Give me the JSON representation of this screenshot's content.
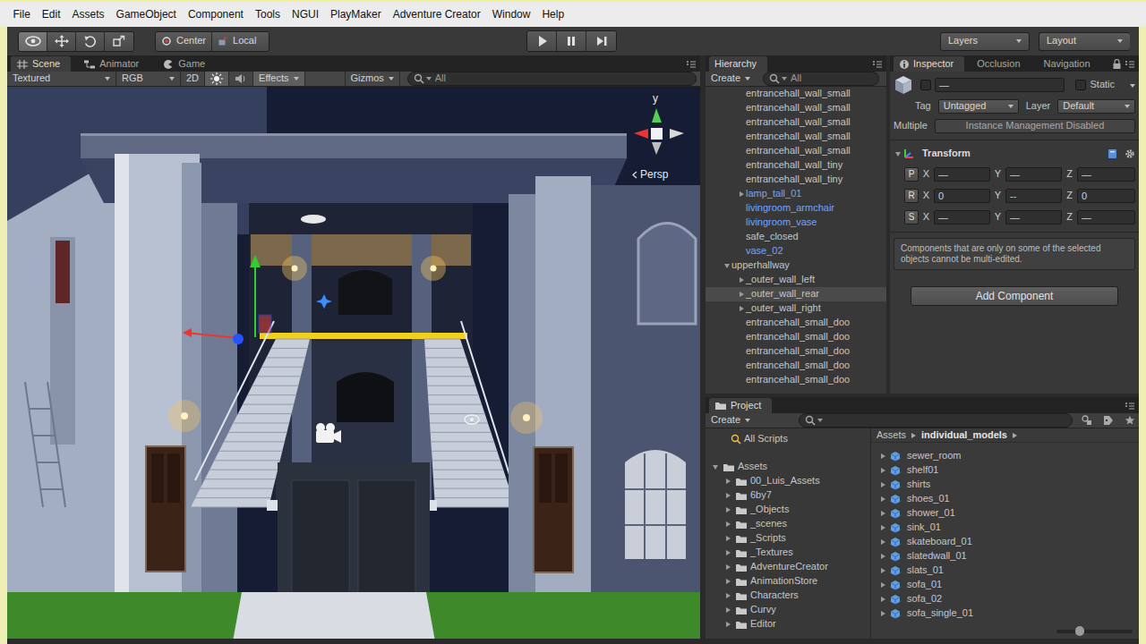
{
  "menu": {
    "items": [
      "File",
      "Edit",
      "Assets",
      "GameObject",
      "Component",
      "Tools",
      "NGUI",
      "PlayMaker",
      "Adventure Creator",
      "Window",
      "Help"
    ]
  },
  "toolbar": {
    "tools": [
      {
        "selected": true
      },
      {
        "selected": false
      },
      {
        "selected": false
      },
      {
        "selected": false
      }
    ],
    "pivot_mode": "Center",
    "pivot_rotation": "Local",
    "layers": "Layers",
    "layout": "Layout"
  },
  "scene": {
    "tabs": [
      {
        "label": "Scene",
        "selected": true
      },
      {
        "label": "Animator",
        "selected": false
      },
      {
        "label": "Game",
        "selected": false
      }
    ],
    "shading": "Textured",
    "render_mode": "RGB",
    "mode_2d": "2D",
    "mode_2d_on": false,
    "lighting_on": true,
    "audio_on": false,
    "effects": "Effects",
    "effects_on": true,
    "gizmos": "Gizmos",
    "search": {
      "placeholder": "All"
    },
    "axis_label": "y",
    "projection": "Persp"
  },
  "hierarchy": {
    "tab": "Hierarchy",
    "create": "Create",
    "search": {
      "placeholder": "All"
    },
    "items": [
      {
        "label": "entrancehall_wall_small",
        "depth": 1,
        "has_children": false,
        "expanded": false,
        "prefab": false,
        "selected": false
      },
      {
        "label": "entrancehall_wall_small",
        "depth": 1,
        "has_children": false,
        "expanded": false,
        "prefab": false,
        "selected": false
      },
      {
        "label": "entrancehall_wall_small",
        "depth": 1,
        "has_children": false,
        "expanded": false,
        "prefab": false,
        "selected": false
      },
      {
        "label": "entrancehall_wall_small",
        "depth": 1,
        "has_children": false,
        "expanded": false,
        "prefab": false,
        "selected": false
      },
      {
        "label": "entrancehall_wall_small",
        "depth": 1,
        "has_children": false,
        "expanded": false,
        "prefab": false,
        "selected": false
      },
      {
        "label": "entrancehall_wall_tiny",
        "depth": 1,
        "has_children": false,
        "expanded": false,
        "prefab": false,
        "selected": false
      },
      {
        "label": "entrancehall_wall_tiny",
        "depth": 1,
        "has_children": false,
        "expanded": false,
        "prefab": false,
        "selected": false
      },
      {
        "label": "lamp_tall_01",
        "depth": 1,
        "has_children": true,
        "expanded": false,
        "prefab": true,
        "selected": false
      },
      {
        "label": "livingroom_armchair",
        "depth": 1,
        "has_children": false,
        "expanded": false,
        "prefab": true,
        "selected": false
      },
      {
        "label": "livingroom_vase",
        "depth": 1,
        "has_children": false,
        "expanded": false,
        "prefab": true,
        "selected": false
      },
      {
        "label": "safe_closed",
        "depth": 1,
        "has_children": false,
        "expanded": false,
        "prefab": false,
        "selected": false
      },
      {
        "label": "vase_02",
        "depth": 1,
        "has_children": false,
        "expanded": false,
        "prefab": true,
        "selected": false
      },
      {
        "label": "upperhallway",
        "depth": 0,
        "has_children": true,
        "expanded": true,
        "prefab": false,
        "selected": false
      },
      {
        "label": "_outer_wall_left",
        "depth": 1,
        "has_children": true,
        "expanded": false,
        "prefab": false,
        "selected": false
      },
      {
        "label": "_outer_wall_rear",
        "depth": 1,
        "has_children": true,
        "expanded": false,
        "prefab": false,
        "selected": true
      },
      {
        "label": "_outer_wall_right",
        "depth": 1,
        "has_children": true,
        "expanded": false,
        "prefab": false,
        "selected": false
      },
      {
        "label": "entrancehall_small_doo",
        "depth": 1,
        "has_children": false,
        "expanded": false,
        "prefab": false,
        "selected": false
      },
      {
        "label": "entrancehall_small_doo",
        "depth": 1,
        "has_children": false,
        "expanded": false,
        "prefab": false,
        "selected": false
      },
      {
        "label": "entrancehall_small_doo",
        "depth": 1,
        "has_children": false,
        "expanded": false,
        "prefab": false,
        "selected": false
      },
      {
        "label": "entrancehall_small_doo",
        "depth": 1,
        "has_children": false,
        "expanded": false,
        "prefab": false,
        "selected": false
      },
      {
        "label": "entrancehall_small_doo",
        "depth": 1,
        "has_children": false,
        "expanded": false,
        "prefab": false,
        "selected": false
      }
    ]
  },
  "inspector": {
    "tabs": [
      {
        "label": "Inspector",
        "selected": true
      },
      {
        "label": "Occlusion",
        "selected": false
      },
      {
        "label": "Navigation",
        "selected": false
      }
    ],
    "active": false,
    "name": "—",
    "static_label": "Static",
    "static": false,
    "tag_label": "Tag",
    "tag": "Untagged",
    "layer_label": "Layer",
    "layer": "Default",
    "prefab_label": "Multiple",
    "prefab_value": "Instance Management Disabled",
    "component": {
      "title": "Transform",
      "expanded": true,
      "rows": [
        {
          "label": "P",
          "fields": [
            {
              "axis": "X",
              "value": "—"
            },
            {
              "axis": "Y",
              "value": "—"
            },
            {
              "axis": "Z",
              "value": "—"
            }
          ]
        },
        {
          "label": "R",
          "fields": [
            {
              "axis": "X",
              "value": "0"
            },
            {
              "axis": "Y",
              "value": "--"
            },
            {
              "axis": "Z",
              "value": "0"
            }
          ]
        },
        {
          "label": "S",
          "fields": [
            {
              "axis": "X",
              "value": "—"
            },
            {
              "axis": "Y",
              "value": "—"
            },
            {
              "axis": "Z",
              "value": "—"
            }
          ]
        }
      ]
    },
    "note": "Components that are only on some of the selected objects cannot be multi-edited.",
    "add_button": "Add Component"
  },
  "project": {
    "tab": "Project",
    "create": "Create",
    "favorites": [
      {
        "label": "All Scripts"
      }
    ],
    "tree": [
      {
        "label": "Assets",
        "depth": 0,
        "expanded": true
      },
      {
        "label": "00_Luis_Assets",
        "depth": 1,
        "expanded": false
      },
      {
        "label": "6by7",
        "depth": 1,
        "expanded": false
      },
      {
        "label": "_Objects",
        "depth": 1,
        "expanded": false
      },
      {
        "label": "_scenes",
        "depth": 1,
        "expanded": false
      },
      {
        "label": "_Scripts",
        "depth": 1,
        "expanded": false
      },
      {
        "label": "_Textures",
        "depth": 1,
        "expanded": false
      },
      {
        "label": "AdventureCreator",
        "depth": 1,
        "expanded": false
      },
      {
        "label": "AnimationStore",
        "depth": 1,
        "expanded": false
      },
      {
        "label": "Characters",
        "depth": 1,
        "expanded": false
      },
      {
        "label": "Curvy",
        "depth": 1,
        "expanded": false
      },
      {
        "label": "Editor",
        "depth": 1,
        "expanded": false
      }
    ],
    "breadcrumb": [
      "Assets",
      "individual_models"
    ],
    "files": [
      "sewer_room",
      "shelf01",
      "shirts",
      "shoes_01",
      "shower_01",
      "sink_01",
      "skateboard_01",
      "slatedwall_01",
      "slats_01",
      "sofa_01",
      "sofa_02",
      "sofa_single_01"
    ],
    "icon_size": {
      "level": 0.3
    }
  }
}
